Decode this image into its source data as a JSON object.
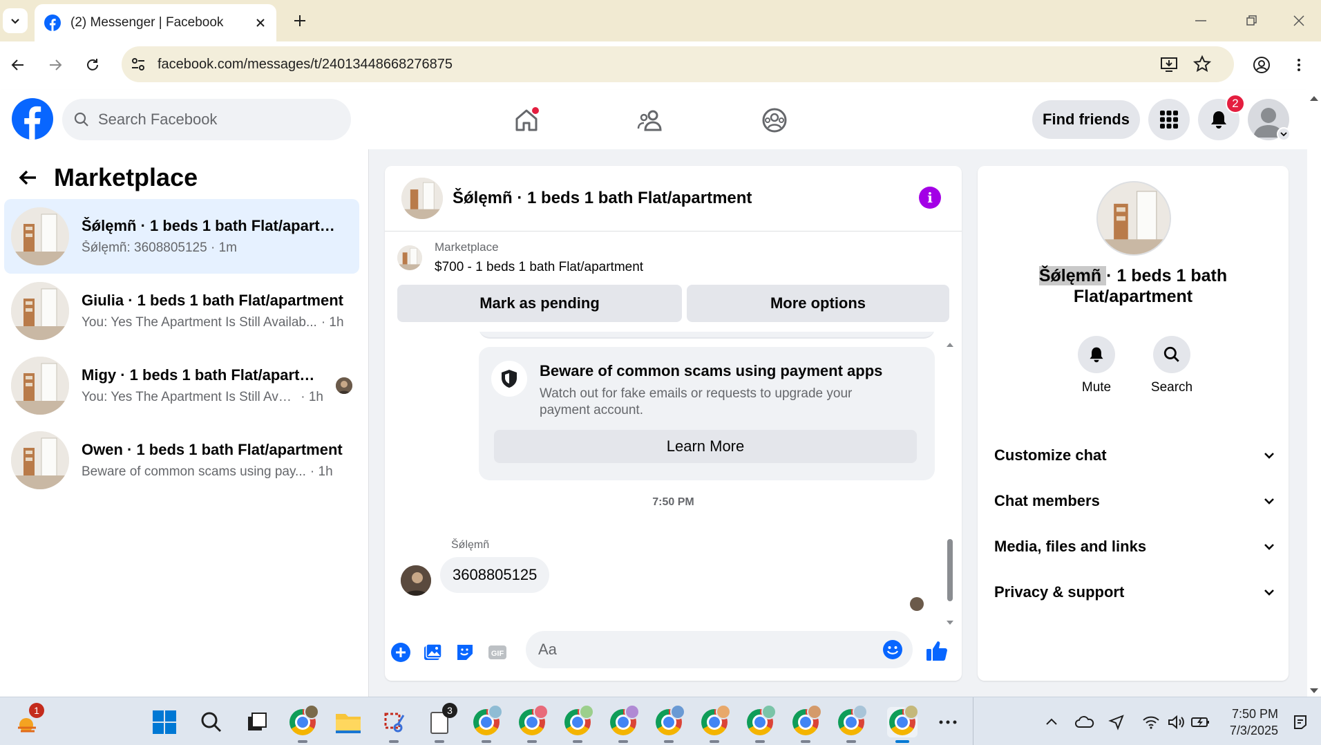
{
  "browser": {
    "tab_title": "(2) Messenger | Facebook",
    "url": "facebook.com/messages/t/24013448668276875"
  },
  "header": {
    "search_placeholder": "Search Facebook",
    "find_friends": "Find friends",
    "notification_count": "2"
  },
  "sidebar": {
    "title": "Marketplace",
    "conversations": [
      {
        "name": "Šǿlęmñ · 1 beds 1 bath Flat/apartm...",
        "snippet": "Šǿlęmñ: 3608805125 · 1m",
        "time": "",
        "active": true
      },
      {
        "name": "Giulia · 1 beds 1 bath Flat/apartment",
        "snippet": "You: Yes The Apartment Is Still Availab...",
        "time": "· 1h"
      },
      {
        "name": "Migy · 1 beds 1 bath Flat/apartm...",
        "snippet": "You: Yes The Apartment Is Still Avail...",
        "time": "· 1h"
      },
      {
        "name": "Owen · 1 beds 1 bath Flat/apartment",
        "snippet": "Beware of common scams using pay...",
        "time": "· 1h"
      }
    ]
  },
  "chat": {
    "title": "Šǿlęmñ · 1 beds 1 bath Flat/apartment",
    "listing_category": "Marketplace",
    "listing_price_title": "$700 - 1 beds 1 bath Flat/apartment",
    "mark_pending": "Mark as pending",
    "more_options": "More options",
    "scam_title": "Beware of common scams using payment apps",
    "scam_body": "Watch out for fake emails or requests to upgrade your payment account.",
    "learn_more": "Learn More",
    "timestamp": "7:50 PM",
    "sender_name": "Šǿlęmñ",
    "message": "3608805125",
    "input_placeholder": "Aa"
  },
  "details": {
    "name_highlight": "Šǿlęmñ ",
    "name_rest": "· 1 beds 1 bath Flat/apartment",
    "mute": "Mute",
    "search": "Search",
    "sections": [
      "Customize chat",
      "Chat members",
      "Media, files and links",
      "Privacy & support"
    ]
  },
  "taskbar": {
    "time": "7:50 PM",
    "date": "7/3/2025",
    "weather_badge": "1",
    "notepad_badge": "3"
  },
  "colors": {
    "fb_blue": "#0866ff",
    "active_conv": "#e6f1ff",
    "info_purple": "#a300e6",
    "badge_red": "#e41e3f"
  }
}
